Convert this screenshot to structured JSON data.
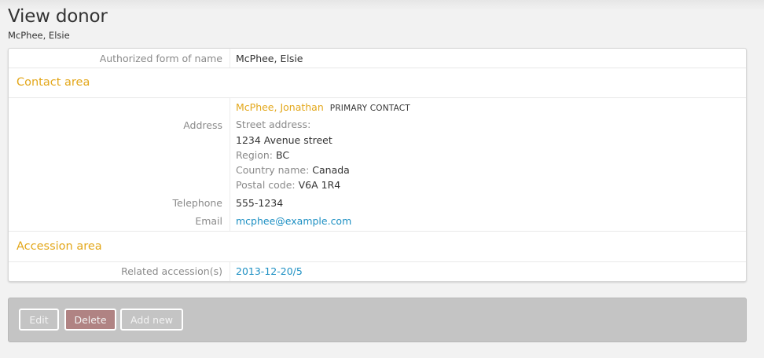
{
  "page": {
    "title": "View donor",
    "subtitle": "McPhee, Elsie"
  },
  "identity": {
    "authorized_name_label": "Authorized form of name",
    "authorized_name_value": "McPhee, Elsie"
  },
  "contact_area": {
    "title": "Contact area",
    "address_label": "Address",
    "contact_name": "McPhee, Jonathan",
    "primary_badge": "PRIMARY CONTACT",
    "street_label": "Street address:",
    "street_value": "1234 Avenue street",
    "region_label": "Region:",
    "region_value": "BC",
    "country_label": "Country name:",
    "country_value": "Canada",
    "postal_label": "Postal code:",
    "postal_value": "V6A 1R4",
    "telephone_label": "Telephone",
    "telephone_value": "555-1234",
    "email_label": "Email",
    "email_value": "mcphee@example.com"
  },
  "accession_area": {
    "title": "Accession area",
    "related_label": "Related accession(s)",
    "related_value": "2013-12-20/5"
  },
  "actions": {
    "edit": "Edit",
    "delete": "Delete",
    "add_new": "Add new"
  },
  "colors": {
    "section_title": "#e3a71a",
    "link": "#1e90c3",
    "delete_button": "#b08383",
    "action_bar": "#c4c4c4"
  }
}
